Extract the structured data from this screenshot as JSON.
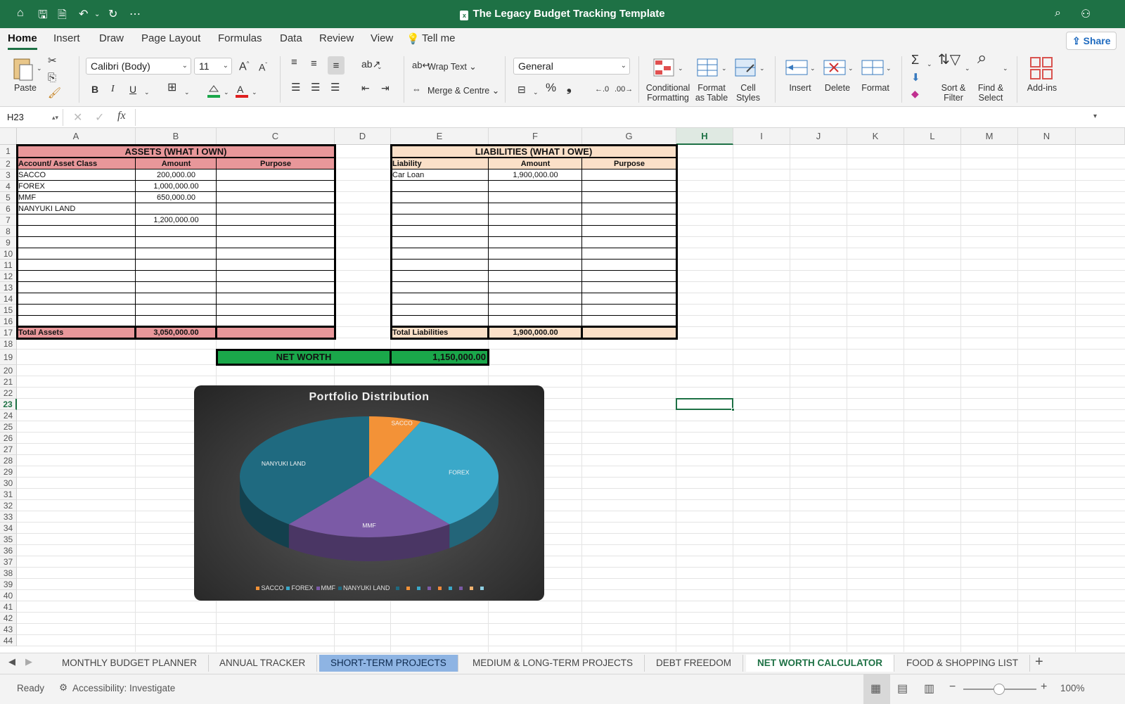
{
  "app": {
    "title": "The Legacy Budget Tracking Template"
  },
  "menu": {
    "tabs": [
      "Home",
      "Insert",
      "Draw",
      "Page Layout",
      "Formulas",
      "Data",
      "Review",
      "View"
    ],
    "tell_me": "Tell me",
    "share": "Share"
  },
  "ribbon": {
    "paste": "Paste",
    "font_name": "Calibri (Body)",
    "font_size": "11",
    "wrap_text": "Wrap Text",
    "merge_centre": "Merge & Centre",
    "number_format": "General",
    "conditional_formatting": [
      "Conditional",
      "Formatting"
    ],
    "format_as_table": [
      "Format",
      "as Table"
    ],
    "cell_styles": [
      "Cell",
      "Styles"
    ],
    "insert": "Insert",
    "delete": "Delete",
    "format": "Format",
    "sort_filter": [
      "Sort &",
      "Filter"
    ],
    "find_select": [
      "Find &",
      "Select"
    ],
    "addins": "Add-ins"
  },
  "formula_bar": {
    "name_box": "H23",
    "fx": "fx",
    "value": ""
  },
  "columns": [
    "A",
    "B",
    "C",
    "D",
    "E",
    "F",
    "G",
    "H",
    "I",
    "J",
    "K",
    "L",
    "M",
    "N"
  ],
  "rows": [
    "1",
    "2",
    "3",
    "4",
    "5",
    "6",
    "7",
    "8",
    "9",
    "10",
    "11",
    "12",
    "13",
    "14",
    "15",
    "16",
    "17",
    "18",
    "19",
    "20",
    "21",
    "22",
    "23",
    "24",
    "25",
    "26",
    "27",
    "28",
    "29",
    "30",
    "31",
    "32",
    "33",
    "34",
    "35",
    "36",
    "37",
    "38",
    "39",
    "40",
    "41",
    "42",
    "43",
    "44"
  ],
  "selected_cell": {
    "col": "H",
    "row": "23"
  },
  "assets": {
    "title": "ASSETS (WHAT I OWN)",
    "headers": [
      "Account/ Asset Class",
      "Amount",
      "Purpose"
    ],
    "rows": [
      [
        "SACCO",
        "200,000.00",
        ""
      ],
      [
        "FOREX",
        "1,000,000.00",
        ""
      ],
      [
        "MMF",
        "650,000.00",
        ""
      ],
      [
        "NANYUKI LAND",
        "",
        ""
      ],
      [
        "",
        "1,200,000.00",
        ""
      ]
    ],
    "total_label": "Total Assets",
    "total_value": "3,050,000.00",
    "color": "#e8979a"
  },
  "liabilities": {
    "title": "LIABILITIES (WHAT I OWE)",
    "headers": [
      "Liability",
      "Amount",
      "Purpose"
    ],
    "rows": [
      [
        "Car Loan",
        "1,900,000.00",
        ""
      ]
    ],
    "total_label": "Total Liabilities",
    "total_value": "1,900,000.00",
    "color": "#fbe0c8"
  },
  "net_worth": {
    "label": "NET WORTH",
    "value": "1,150,000.00",
    "color": "#1aa74a"
  },
  "chart_data": {
    "type": "pie",
    "title": "Portfolio Distribution",
    "categories": [
      "SACCO",
      "FOREX",
      "MMF",
      "NANYUKI LAND"
    ],
    "values": [
      200000,
      1000000,
      650000,
      1200000
    ],
    "colors": [
      "#f39237",
      "#3aa8c9",
      "#7b5aa6",
      "#1f6a80"
    ],
    "legend": "bottom",
    "three_d": true,
    "extra_legend_swatches": [
      "#1f6a80",
      "#f39237",
      "#3aa8c9",
      "#7b5aa6",
      "#f08a3c",
      "#3aa8c9",
      "#7b5aa6",
      "#f2b36f",
      "#8fd0e3"
    ]
  },
  "sheet_tabs": [
    "MONTHLY BUDGET PLANNER",
    "ANNUAL TRACKER",
    "SHORT-TERM PROJECTS",
    "MEDIUM & LONG-TERM PROJECTS",
    "DEBT FREEDOM",
    "NET WORTH CALCULATOR",
    "FOOD & SHOPPING LIST"
  ],
  "active_sheet": "NET WORTH CALCULATOR",
  "status": {
    "ready": "Ready",
    "accessibility": "Accessibility: Investigate",
    "zoom": "100%"
  }
}
